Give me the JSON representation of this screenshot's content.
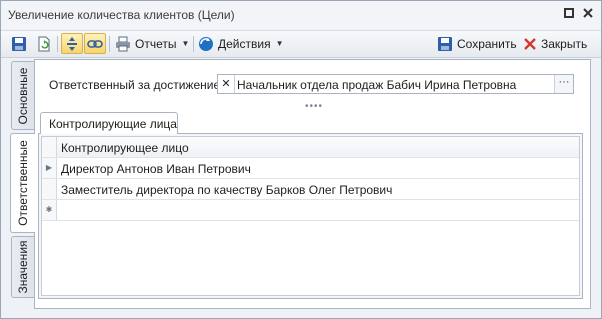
{
  "window": {
    "title": "Увеличение количества клиентов (Цели)",
    "controls": [
      "restore-icon",
      "close-icon"
    ]
  },
  "toolbar": {
    "buttons": [
      {
        "icon": "save-disk-icon"
      },
      {
        "icon": "refresh-document-icon"
      },
      {
        "icon": "expand-vertical-icon"
      },
      {
        "icon": "link-chain-icon"
      }
    ],
    "reports_label": "Отчеты",
    "actions_label": "Действия",
    "save_label": "Сохранить",
    "close_label": "Закрыть"
  },
  "side_tabs": [
    {
      "label": "Основные",
      "active": false
    },
    {
      "label": "Ответственные",
      "active": true
    },
    {
      "label": "Значения",
      "active": false
    }
  ],
  "responsible": {
    "label": "Ответственный за достижение:",
    "value": "Начальник отдела продаж Бабич Ирина Петровна",
    "clear_glyph": "✕",
    "browse_glyph": "···"
  },
  "splitter_glyph": "••••",
  "subtab": {
    "label": "Контролирующие лица"
  },
  "grid": {
    "column_header": "Контролирующее лицо",
    "rows": [
      "Директор Антонов Иван Петрович",
      "Заместитель директора по качеству Барков Олег Петрович"
    ],
    "current_row_glyph": "▶",
    "new_row_glyph": "✱"
  },
  "colors": {
    "active_tool": "#f7d36a",
    "close_x": "#d23a2a",
    "accent_blue": "#1f6fc5"
  }
}
